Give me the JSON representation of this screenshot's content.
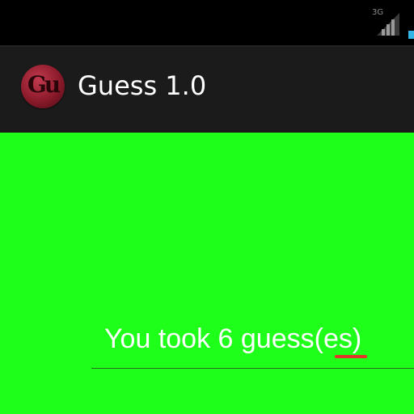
{
  "status_bar": {
    "network_label": "3G",
    "icons": [
      "signal-icon",
      "battery-icon"
    ]
  },
  "action_bar": {
    "app_icon_letters": "Gu",
    "title": "Guess 1.0"
  },
  "main": {
    "result_text": "You took 6 guess(es)",
    "background_color": "#1eff1a"
  },
  "colors": {
    "action_bar_bg": "#1b1b1b",
    "content_bg": "#1eff1a",
    "spellcheck_underline": "#e2352a"
  }
}
